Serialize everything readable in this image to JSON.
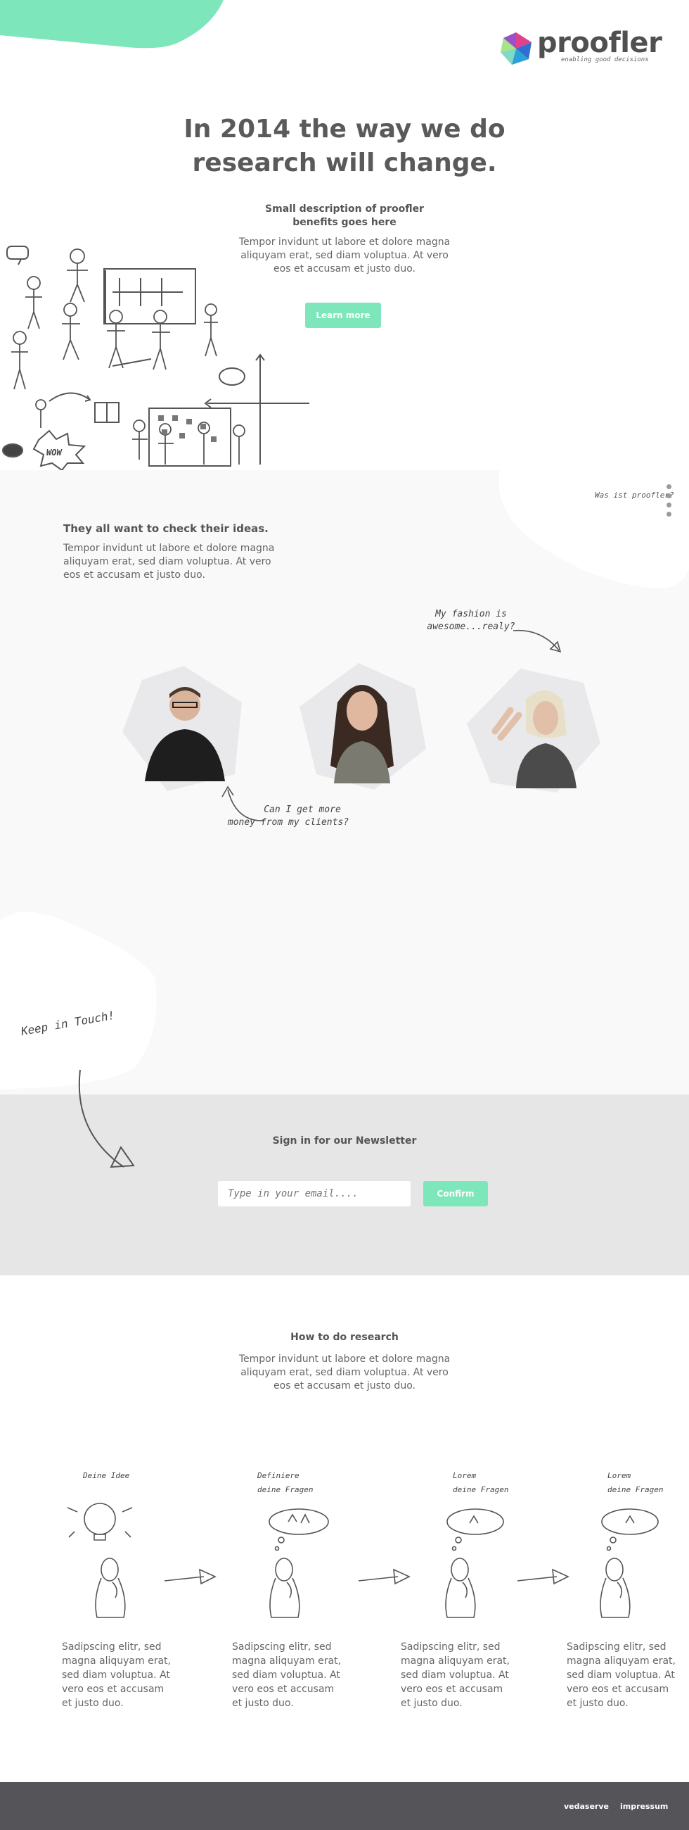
{
  "brand": {
    "name": "proofler",
    "tagline": "enabling good decisions"
  },
  "hero": {
    "headline_1": "In 2014 the way we do",
    "headline_2": "research will change.",
    "sub_1": "Small description of proofler",
    "sub_2": "benefits goes here",
    "text_1": "Tempor invidunt ut labore et dolore magna",
    "text_2": "aliquyam erat, sed diam voluptua. At vero",
    "text_3": "eos et accusam et justo duo.",
    "cta": "Learn more",
    "sketch_word": "WOW"
  },
  "side_nav": {
    "label": "Was ist proofler?"
  },
  "ideas": {
    "title": "They all want to check their ideas.",
    "text_1": "Tempor invidunt ut labore et dolore magna",
    "text_2": "aliquyam erat, sed diam voluptua. At vero",
    "text_3": "eos et accusam et justo duo.",
    "quote_top_1": "My fashion is",
    "quote_top_2": "awesome...realy?",
    "quote_bottom_1": "Can I get more",
    "quote_bottom_2": "money from my clients?"
  },
  "newsletter": {
    "handwritten": "Keep in Touch!",
    "title": "Sign in for our Newsletter",
    "placeholder": "Type in your email....",
    "button": "Confirm"
  },
  "howto": {
    "title": "How to do research",
    "text_1": "Tempor invidunt ut labore et dolore magna",
    "text_2": "aliquyam erat, sed diam voluptua. At vero",
    "text_3": "eos et accusam et justo duo.",
    "steps": [
      {
        "label_1": "Deine Idee",
        "label_2": "",
        "l1": "Sadipscing elitr, sed",
        "l2": "magna aliquyam erat,",
        "l3": "sed diam voluptua. At",
        "l4": "vero eos et accusam",
        "l5": "et justo duo."
      },
      {
        "label_1": "Definiere",
        "label_2": "deine Fragen",
        "l1": "Sadipscing elitr, sed",
        "l2": "magna aliquyam erat,",
        "l3": "sed diam voluptua. At",
        "l4": "vero eos et accusam",
        "l5": "et justo duo."
      },
      {
        "label_1": "Lorem",
        "label_2": "deine Fragen",
        "l1": "Sadipscing elitr, sed",
        "l2": "magna aliquyam erat,",
        "l3": "sed diam voluptua. At",
        "l4": "vero eos et accusam",
        "l5": "et justo duo."
      },
      {
        "label_1": "Lorem",
        "label_2": "deine Fragen",
        "l1": "Sadipscing elitr, sed",
        "l2": "magna aliquyam erat,",
        "l3": "sed diam voluptua. At",
        "l4": "vero eos et accusam",
        "l5": "et justo duo."
      }
    ]
  },
  "footer": {
    "link_1": "vedaserve",
    "link_2": "impressum"
  },
  "colors": {
    "mint": "#7ee6bb",
    "grey_bg": "#f9f9f9",
    "newsletter_bg": "#e6e6e6",
    "footer_bg": "#555559"
  }
}
